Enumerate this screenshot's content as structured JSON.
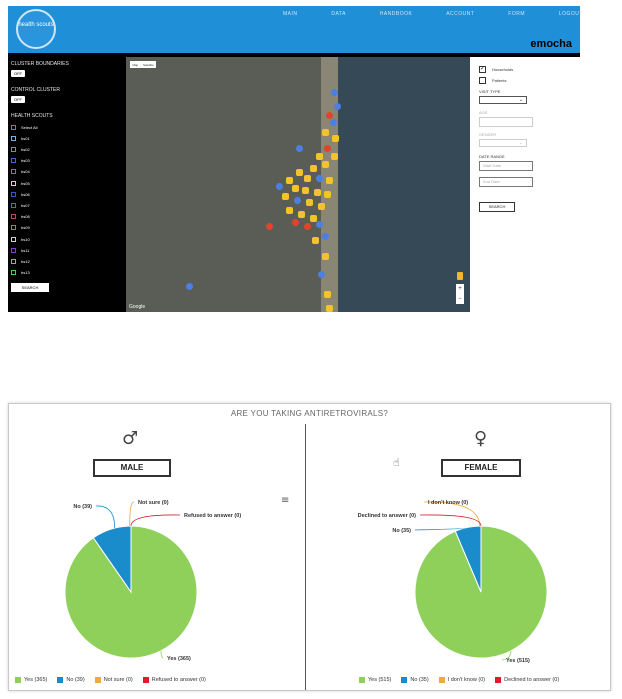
{
  "app": {
    "logo_text": "health scouts",
    "brand": "emocha",
    "nav": [
      "MAIN",
      "DATA",
      "HANDBOOK",
      "ACCOUNT",
      "FORM",
      "LOGOUT"
    ]
  },
  "left_panel": {
    "cluster_boundaries": "CLUSTER BOUNDARIES",
    "control_cluster": "CONTROL CLUSTER",
    "toggle_off": "OFF",
    "health_scouts": "HEALTH SCOUTS",
    "scouts": [
      {
        "name": "Select All",
        "color": "#3a8fd6"
      },
      {
        "name": "hs01",
        "color": "#7ab0e8"
      },
      {
        "name": "hs02",
        "color": "#8a7ad6"
      },
      {
        "name": "hs03",
        "color": "#4d5fe0"
      },
      {
        "name": "hs04",
        "color": "#d64a8a"
      },
      {
        "name": "hs05",
        "color": "#e6e040"
      },
      {
        "name": "hs06",
        "color": "#3a54d6"
      },
      {
        "name": "hs07",
        "color": "#e03a3a"
      },
      {
        "name": "hs08",
        "color": "#d63a6a"
      },
      {
        "name": "hs09",
        "color": "#3ab06a"
      },
      {
        "name": "hs10",
        "color": "#d0d0d0"
      },
      {
        "name": "hs11",
        "color": "#8a3ad6"
      },
      {
        "name": "hs12",
        "color": "#e6963a"
      },
      {
        "name": "hs13",
        "color": "#3ad650"
      }
    ],
    "search": "SEARCH"
  },
  "map": {
    "type_map": "Map",
    "type_satellite": "Satellite",
    "attribution": "Google",
    "zoom_in": "+",
    "zoom_out": "−"
  },
  "right_panel": {
    "households": "Households",
    "patients": "Patients",
    "visit_type": "VISIT TYPE",
    "age": "AGE",
    "gender": "GENDER",
    "date_range": "DATE RANGE",
    "start_placeholder": "Start Date",
    "end_placeholder": "End Date",
    "search": "SEARCH"
  },
  "chart_panel": {
    "title": "ARE YOU TAKING ANTIRETROVIRALS?",
    "male_symbol": "♂",
    "female_symbol": "♀",
    "menu_glyph": "≡",
    "cursor_glyph": "☝"
  },
  "chart_data": [
    {
      "type": "pie",
      "title": "MALE",
      "categories": [
        "Yes",
        "No",
        "Not sure",
        "Refused to answer"
      ],
      "values": [
        365,
        39,
        0,
        0
      ],
      "colors": [
        "#8ed05a",
        "#1a8ccb",
        "#f2a83c",
        "#d61f2a"
      ],
      "data_labels": [
        "Yes (365)",
        "No (39)",
        "Not sure (0)",
        "Refused to answer (0)"
      ],
      "legend": [
        "Yes (365)",
        "No (39)",
        "Not sure (0)",
        "Refused to answer (0)"
      ],
      "legend_placement": "bottom"
    },
    {
      "type": "pie",
      "title": "FEMALE",
      "categories": [
        "Yes",
        "No",
        "I don't know",
        "Declined to answer"
      ],
      "values": [
        515,
        35,
        0,
        0
      ],
      "colors": [
        "#8ed05a",
        "#1a8ccb",
        "#f2a83c",
        "#d61f2a"
      ],
      "data_labels": [
        "Yes (515)",
        "No (35)",
        "I don't know (0)",
        "Declined to answer (0)"
      ],
      "legend": [
        "Yes (515)",
        "No (35)",
        "I don't know (0)",
        "Declined to answer (0)"
      ],
      "legend_placement": "bottom"
    }
  ]
}
